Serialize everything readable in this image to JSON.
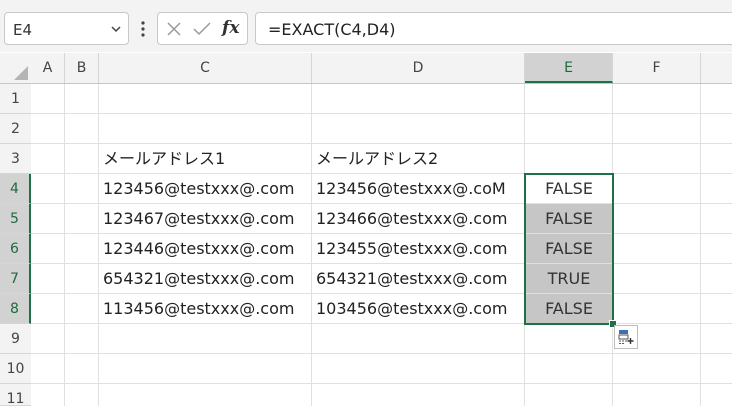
{
  "name_box": {
    "value": "E4"
  },
  "formula_bar": {
    "value": "=EXACT(C4,D4)",
    "fx_label": "fx"
  },
  "columns": [
    "A",
    "B",
    "C",
    "D",
    "E",
    "F"
  ],
  "rows": [
    "1",
    "2",
    "3",
    "4",
    "5",
    "6",
    "7",
    "8",
    "9",
    "10",
    "11"
  ],
  "selected_column": "E",
  "selected_rows": [
    "4",
    "5",
    "6",
    "7",
    "8"
  ],
  "cells": {
    "C3": "メールアドレス1",
    "D3": "メールアドレス2",
    "C4": "123456@testxxx@.com",
    "D4": "123456@testxxx@.coM",
    "E4": "FALSE",
    "C5": "123467@testxxx@.com",
    "D5": "123466@testxxx@.com",
    "E5": "FALSE",
    "C6": "123446@testxxx@.com",
    "D6": "123455@testxxx@.com",
    "E6": "FALSE",
    "C7": "654321@testxxx@.com",
    "D7": "654321@testxxx@.com",
    "E7": "TRUE",
    "C8": "113456@testxxx@.com",
    "D8": "103456@testxxx@.com",
    "E8": "FALSE"
  },
  "colors": {
    "accent": "#1e7145",
    "selection_fill": "#c6c6c6",
    "header_bg": "#f3f3f3"
  }
}
